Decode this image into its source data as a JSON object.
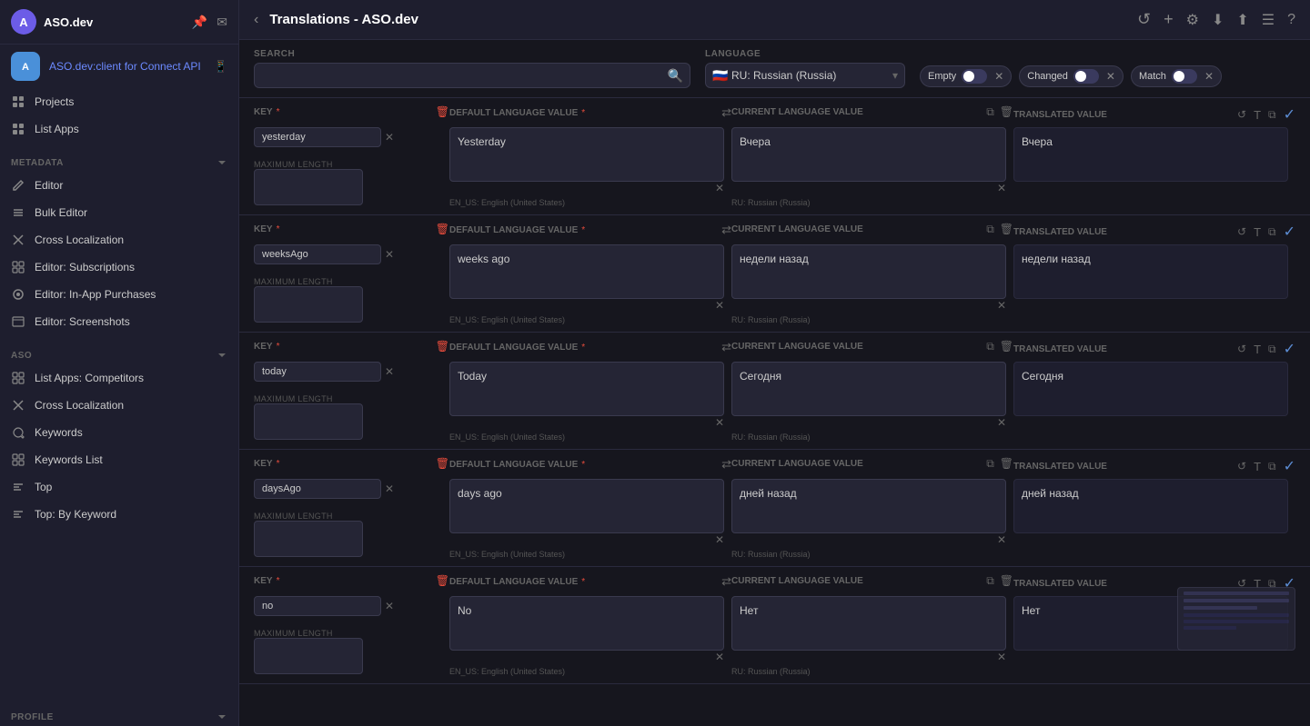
{
  "app": {
    "name": "ASO.dev",
    "logo": "🅰",
    "pin_icon": "📌",
    "mail_icon": "✉"
  },
  "client_app": {
    "name": "ASO.dev:client for Connect API",
    "icon": "🔵",
    "phone_icon": "📱"
  },
  "sidebar": {
    "sections": [
      {
        "title": "METADATA",
        "items": [
          {
            "label": "Editor",
            "icon": "✏️"
          },
          {
            "label": "Bulk Editor",
            "icon": "≡"
          },
          {
            "label": "Cross Localization",
            "icon": "✕"
          },
          {
            "label": "Editor: Subscriptions",
            "icon": "⊞"
          },
          {
            "label": "Editor: In-App Purchases",
            "icon": "◎"
          },
          {
            "label": "Editor: Screenshots",
            "icon": "⊟"
          }
        ]
      },
      {
        "title": "ASO",
        "items": [
          {
            "label": "List Apps: Competitors",
            "icon": "⊞"
          },
          {
            "label": "Cross Localization",
            "icon": "✕"
          },
          {
            "label": "Keywords",
            "icon": "🔑"
          },
          {
            "label": "Keywords List",
            "icon": "⊞"
          },
          {
            "label": "Top",
            "icon": "≡"
          },
          {
            "label": "Top: By Keyword",
            "icon": "≡"
          }
        ]
      }
    ],
    "bottom_section": {
      "title": "PROFILE",
      "collapsed": false
    }
  },
  "topbar": {
    "back_icon": "‹",
    "title": "Translations - ASO.dev",
    "actions": [
      "↺",
      "+",
      "⚙",
      "⬇",
      "⬆",
      "☰",
      "?"
    ]
  },
  "filters": {
    "search_label": "SEARCH",
    "search_placeholder": "",
    "language_label": "LANGUAGE",
    "language_value": "RU: Russian (Russia)",
    "language_flag": "🇷🇺",
    "toggles": [
      {
        "label": "Empty",
        "state": "off"
      },
      {
        "label": "Changed",
        "state": "off"
      },
      {
        "label": "Match",
        "state": "off"
      }
    ]
  },
  "table": {
    "col_key": "KEY",
    "col_key_required": "*",
    "col_default": "DEFAULT LANGUAGE VALUE",
    "col_default_required": "*",
    "col_current": "CURRENT LANGUAGE VALUE",
    "col_translated": "TRANSLATED VALUE",
    "rows": [
      {
        "key": "yesterday",
        "max_length": "",
        "default_value": "Yesterday",
        "default_lang": "EN_US: English (United States)",
        "current_value": "Вчера",
        "current_lang": "RU: Russian (Russia)",
        "translated_value": "Вчера"
      },
      {
        "key": "weeksAgo",
        "max_length": "",
        "default_value": "weeks ago",
        "default_lang": "EN_US: English (United States)",
        "current_value": "недели назад",
        "current_lang": "RU: Russian (Russia)",
        "translated_value": "недели назад"
      },
      {
        "key": "today",
        "max_length": "",
        "default_value": "Today",
        "default_lang": "EN_US: English (United States)",
        "current_value": "Сегодня",
        "current_lang": "RU: Russian (Russia)",
        "translated_value": "Сегодня"
      },
      {
        "key": "daysAgo",
        "max_length": "",
        "default_value": "days ago",
        "default_lang": "EN_US: English (United States)",
        "current_value": "дней назад",
        "current_lang": "RU: Russian (Russia)",
        "translated_value": "дней назад"
      },
      {
        "key": "no",
        "max_length": "",
        "default_value": "No",
        "default_lang": "EN_US: English (United States)",
        "current_value": "Нет",
        "current_lang": "RU: Russian (Russia)",
        "translated_value": "Нет"
      }
    ]
  },
  "icons": {
    "copy": "⧉",
    "delete": "🗑",
    "translate": "T",
    "refresh": "↺",
    "cross": "✕",
    "check": "✓",
    "search": "🔍",
    "chevron_down": "▾"
  },
  "colors": {
    "accent": "#6c8aff",
    "danger": "#e74c3c",
    "bg_dark": "#16161e",
    "bg_mid": "#1e1e2e",
    "bg_input": "#252535",
    "border": "#2a2a3e",
    "text_muted": "#666",
    "blue_check": "#5c8dd4"
  }
}
